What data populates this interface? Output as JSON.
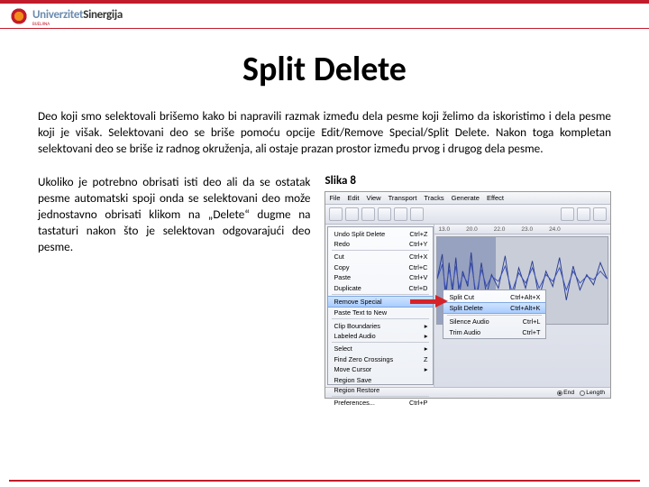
{
  "brand": {
    "name": "Sinergija",
    "prefix": "Univerzitet",
    "sub": "BIJELJINA"
  },
  "title": "Split Delete",
  "para1": "Deo koji smo selektovali brišemo kako bi napravili razmak između dela pesme koji želimo da iskoristimo i dela pesme koji je višak. Selektovani deo se briše pomoću opcije Edit/Remove Special/Split Delete. Nakon toga kompletan selektovani deo se briše iz radnog okruženja, ali ostaje prazan prostor između prvog i drugog dela pesme.",
  "para2": "Ukoliko je potrebno obrisati isti deo ali da se ostatak pesme automatski spoji onda se selektovani deo može jednostavno obrisati klikom na „Delete“ dugme na tastaturi nakon što je selektovan odgovarajući deo pesme.",
  "caption": "Slika 8",
  "app": {
    "menubar": [
      "File",
      "Edit",
      "View",
      "Transport",
      "Tracks",
      "Generate",
      "Effect"
    ],
    "ruler_ticks": [
      "13.0",
      "20.0",
      "22.0",
      "23.0",
      "24.0"
    ],
    "edit_menu": [
      {
        "label": "Undo Split Delete",
        "hint": "Ctrl+Z"
      },
      {
        "label": "Redo",
        "hint": "Ctrl+Y"
      },
      {
        "sep": true
      },
      {
        "label": "Cut",
        "hint": "Ctrl+X"
      },
      {
        "label": "Copy",
        "hint": "Ctrl+C"
      },
      {
        "label": "Paste",
        "hint": "Ctrl+V"
      },
      {
        "label": "Duplicate",
        "hint": "Ctrl+D"
      },
      {
        "sep": true
      },
      {
        "label": "Remove Special",
        "hint": "▸",
        "hl": true
      },
      {
        "label": "Paste Text to New",
        "hint": ""
      },
      {
        "sep": true
      },
      {
        "label": "Clip Boundaries",
        "hint": "▸"
      },
      {
        "label": "Labeled Audio",
        "hint": "▸"
      },
      {
        "sep": true
      },
      {
        "label": "Select",
        "hint": "▸"
      },
      {
        "label": "Find Zero Crossings",
        "hint": "Z"
      },
      {
        "label": "Move Cursor",
        "hint": "▸"
      },
      {
        "label": "Region Save",
        "hint": ""
      },
      {
        "label": "Region Restore",
        "hint": ""
      },
      {
        "sep": true
      },
      {
        "label": "Preferences...",
        "hint": "Ctrl+P"
      }
    ],
    "sub_menu": [
      {
        "label": "Split Cut",
        "hint": "Ctrl+Alt+X"
      },
      {
        "label": "Split Delete",
        "hint": "Ctrl+Alt+K",
        "hl": true
      },
      {
        "sep": true
      },
      {
        "label": "Silence Audio",
        "hint": "Ctrl+L"
      },
      {
        "label": "Trim Audio",
        "hint": "Ctrl+T"
      }
    ],
    "status": {
      "opt1": "End",
      "opt2": "Length"
    }
  }
}
